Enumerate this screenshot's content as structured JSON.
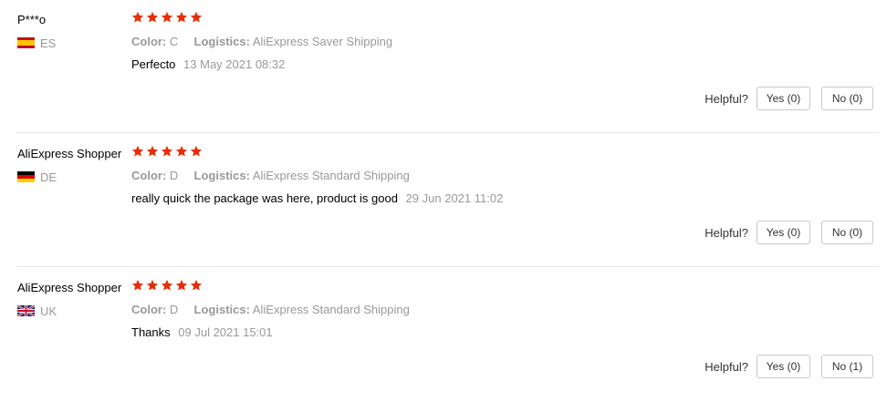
{
  "icons": {
    "rating_star": "star-icon",
    "star_color": "#e62e04"
  },
  "reviews": [
    {
      "user": "P***o",
      "country": "ES",
      "flag": "spain-flag-icon",
      "rating": 5,
      "color_label": "Color:",
      "color_value": "C",
      "logistics_label": "Logistics:",
      "logistics_value": "AliExpress Saver Shipping",
      "text": "Perfecto",
      "date": "13 May 2021 08:32",
      "helpful_label": "Helpful?",
      "yes_label": "Yes (0)",
      "no_label": "No (0)"
    },
    {
      "user": "AliExpress Shopper",
      "country": "DE",
      "flag": "germany-flag-icon",
      "rating": 5,
      "color_label": "Color:",
      "color_value": "D",
      "logistics_label": "Logistics:",
      "logistics_value": "AliExpress Standard Shipping",
      "text": "really quick the package was here, product is good",
      "date": "29 Jun 2021 11:02",
      "helpful_label": "Helpful?",
      "yes_label": "Yes (0)",
      "no_label": "No (0)"
    },
    {
      "user": "AliExpress Shopper",
      "country": "UK",
      "flag": "uk-flag-icon",
      "rating": 5,
      "color_label": "Color:",
      "color_value": "D",
      "logistics_label": "Logistics:",
      "logistics_value": "AliExpress Standard Shipping",
      "text": "Thanks",
      "date": "09 Jul 2021 15:01",
      "helpful_label": "Helpful?",
      "yes_label": "Yes (0)",
      "no_label": "No (1)"
    }
  ]
}
